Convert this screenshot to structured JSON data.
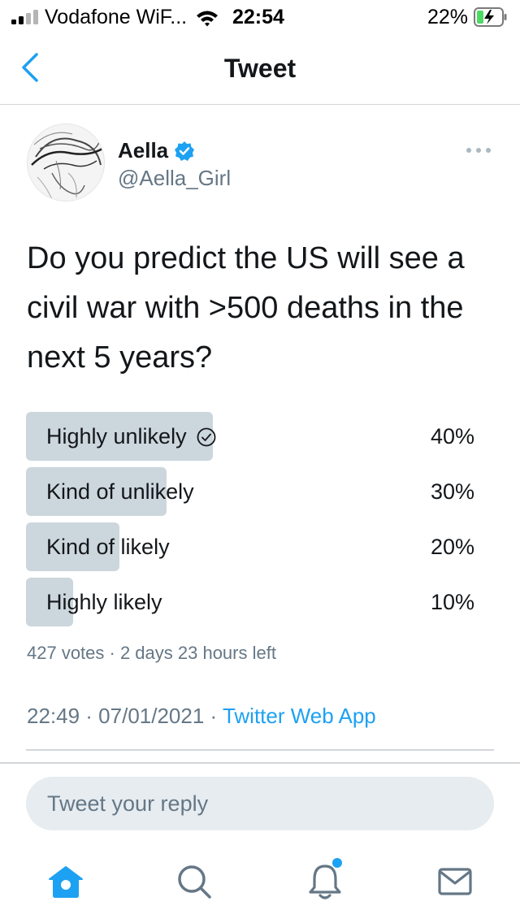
{
  "status_bar": {
    "carrier": "Vodafone WiF...",
    "time": "22:54",
    "battery": "22%"
  },
  "nav": {
    "title": "Tweet"
  },
  "tweet": {
    "display_name": "Aella",
    "handle": "@Aella_Girl",
    "verified": true,
    "text": "Do you predict the US will see a civil war with >500 deaths in the next 5 years?",
    "timestamp": "22:49 · 07/01/2021 · ",
    "source": "Twitter Web App"
  },
  "poll": {
    "options": [
      {
        "label": "Highly unlikely",
        "percent": "40%",
        "value": 40,
        "winner": true
      },
      {
        "label": "Kind of unlikely",
        "percent": "30%",
        "value": 30,
        "winner": false
      },
      {
        "label": "Kind of likely",
        "percent": "20%",
        "value": 20,
        "winner": false
      },
      {
        "label": "Highly likely",
        "percent": "10%",
        "value": 10,
        "winner": false
      }
    ],
    "meta": "427 votes · 2 days 23 hours left"
  },
  "reply": {
    "placeholder": "Tweet your reply"
  },
  "tab_bar": {
    "tabs": [
      "home-icon",
      "search-icon",
      "notifications-icon",
      "messages-icon"
    ],
    "notification_dot": true
  },
  "colors": {
    "accent": "#1da1f2",
    "secondary_text": "#657786",
    "poll_bar": "#ccd6dd",
    "reply_bg": "#e6ecf0"
  }
}
